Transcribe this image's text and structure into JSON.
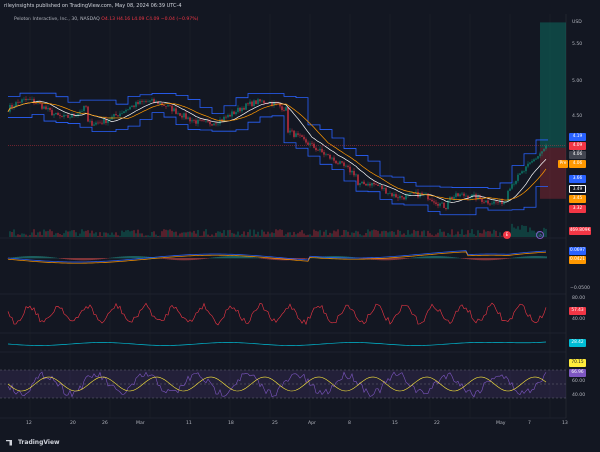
{
  "header": {
    "published_by": "rileyinsights published on TradingView.com, May 08, 2024 06:39 UTC-4",
    "symbol_line": "Peloton Interactive, Inc., 30, NASDAQ",
    "ohlc": "O4.13 H4.16 L4.09 C4.09 −0.04 (−0.97%)"
  },
  "price_axis": {
    "currency": "USD",
    "ticks": [
      "5.50",
      "5.00",
      "4.50",
      "4.00",
      "3.50"
    ]
  },
  "price_tags": [
    {
      "value": "4.19",
      "color": "#2962ff"
    },
    {
      "value": "4.09",
      "color": "#f23645"
    },
    {
      "value": "4.06",
      "color": "#434651"
    },
    {
      "value": "4.06",
      "color": "#ff9800",
      "prefix": "Pre"
    },
    {
      "value": "3.66",
      "color": "#2962ff"
    },
    {
      "value": "3.49",
      "color": "#131722",
      "border": "#ffffff"
    },
    {
      "value": "3.45",
      "color": "#ff9800"
    },
    {
      "value": "3.32",
      "color": "#f23645"
    },
    {
      "value": "469.809K",
      "color": "#f23645"
    }
  ],
  "macd": {
    "tags": [
      "0.0697",
      "0.0421"
    ],
    "tick": "−0.0500"
  },
  "rsi1": {
    "ticks": [
      "80.00",
      "40.00"
    ],
    "tag": "57.43"
  },
  "indicator3": {
    "tag": "28.42"
  },
  "rsi2": {
    "ticks": [
      "80.00",
      "60.00",
      "40.00"
    ],
    "tags": [
      "70.15",
      "66.96"
    ]
  },
  "time_axis": {
    "labels": [
      "12",
      "20",
      "26",
      "Mar",
      "11",
      "18",
      "25",
      "Apr",
      "8",
      "15",
      "22",
      "May",
      "7",
      "13"
    ]
  },
  "footer": {
    "brand": "TradingView"
  },
  "colors": {
    "background": "#131722",
    "up": "#089981",
    "down": "#f23645",
    "band": "#2962ff",
    "ma": "#ff9800"
  }
}
